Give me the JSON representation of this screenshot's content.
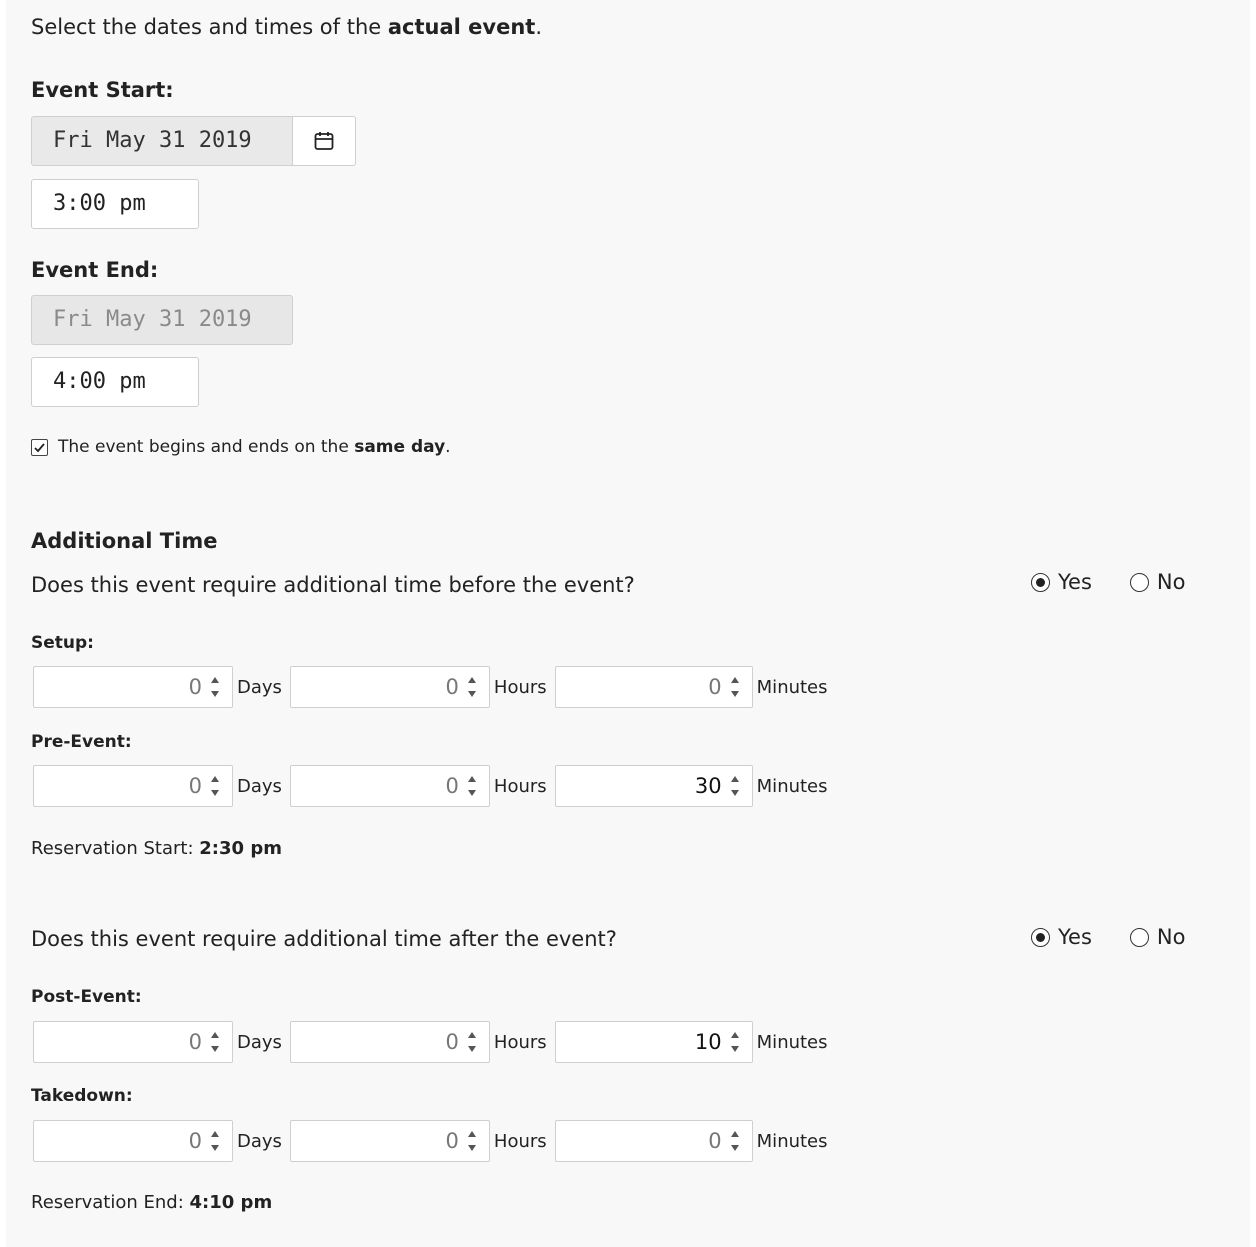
{
  "intro": {
    "prefix": "Select the dates and times of the ",
    "bold": "actual event",
    "suffix": "."
  },
  "event_start": {
    "label": "Event Start:",
    "date": "Fri May 31 2019",
    "time": "3:00 pm",
    "calendar_icon": "calendar-icon"
  },
  "event_end": {
    "label": "Event End:",
    "date": "Fri May 31 2019",
    "time": "4:00 pm"
  },
  "same_day": {
    "checked": true,
    "prefix": "The event begins and ends on the ",
    "bold": "same day",
    "suffix": "."
  },
  "additional": {
    "title": "Additional Time",
    "before": {
      "question": "Does this event require additional time before the event?",
      "yes_label": "Yes",
      "no_label": "No",
      "selected": "Yes",
      "setup": {
        "label": "Setup:",
        "days": "0",
        "hours": "0",
        "minutes": "0"
      },
      "pre_event": {
        "label": "Pre-Event:",
        "days": "0",
        "hours": "0",
        "minutes": "30"
      },
      "reservation": {
        "prefix": "Reservation Start: ",
        "value": "2:30 pm"
      }
    },
    "after": {
      "question": "Does this event require additional time after the event?",
      "yes_label": "Yes",
      "no_label": "No",
      "selected": "Yes",
      "post_event": {
        "label": "Post-Event:",
        "days": "0",
        "hours": "0",
        "minutes": "10"
      },
      "takedown": {
        "label": "Takedown:",
        "days": "0",
        "hours": "0",
        "minutes": "0"
      },
      "reservation": {
        "prefix": "Reservation End: ",
        "value": "4:10 pm"
      }
    }
  },
  "units": {
    "days": "Days",
    "hours": "Hours",
    "minutes": "Minutes"
  }
}
